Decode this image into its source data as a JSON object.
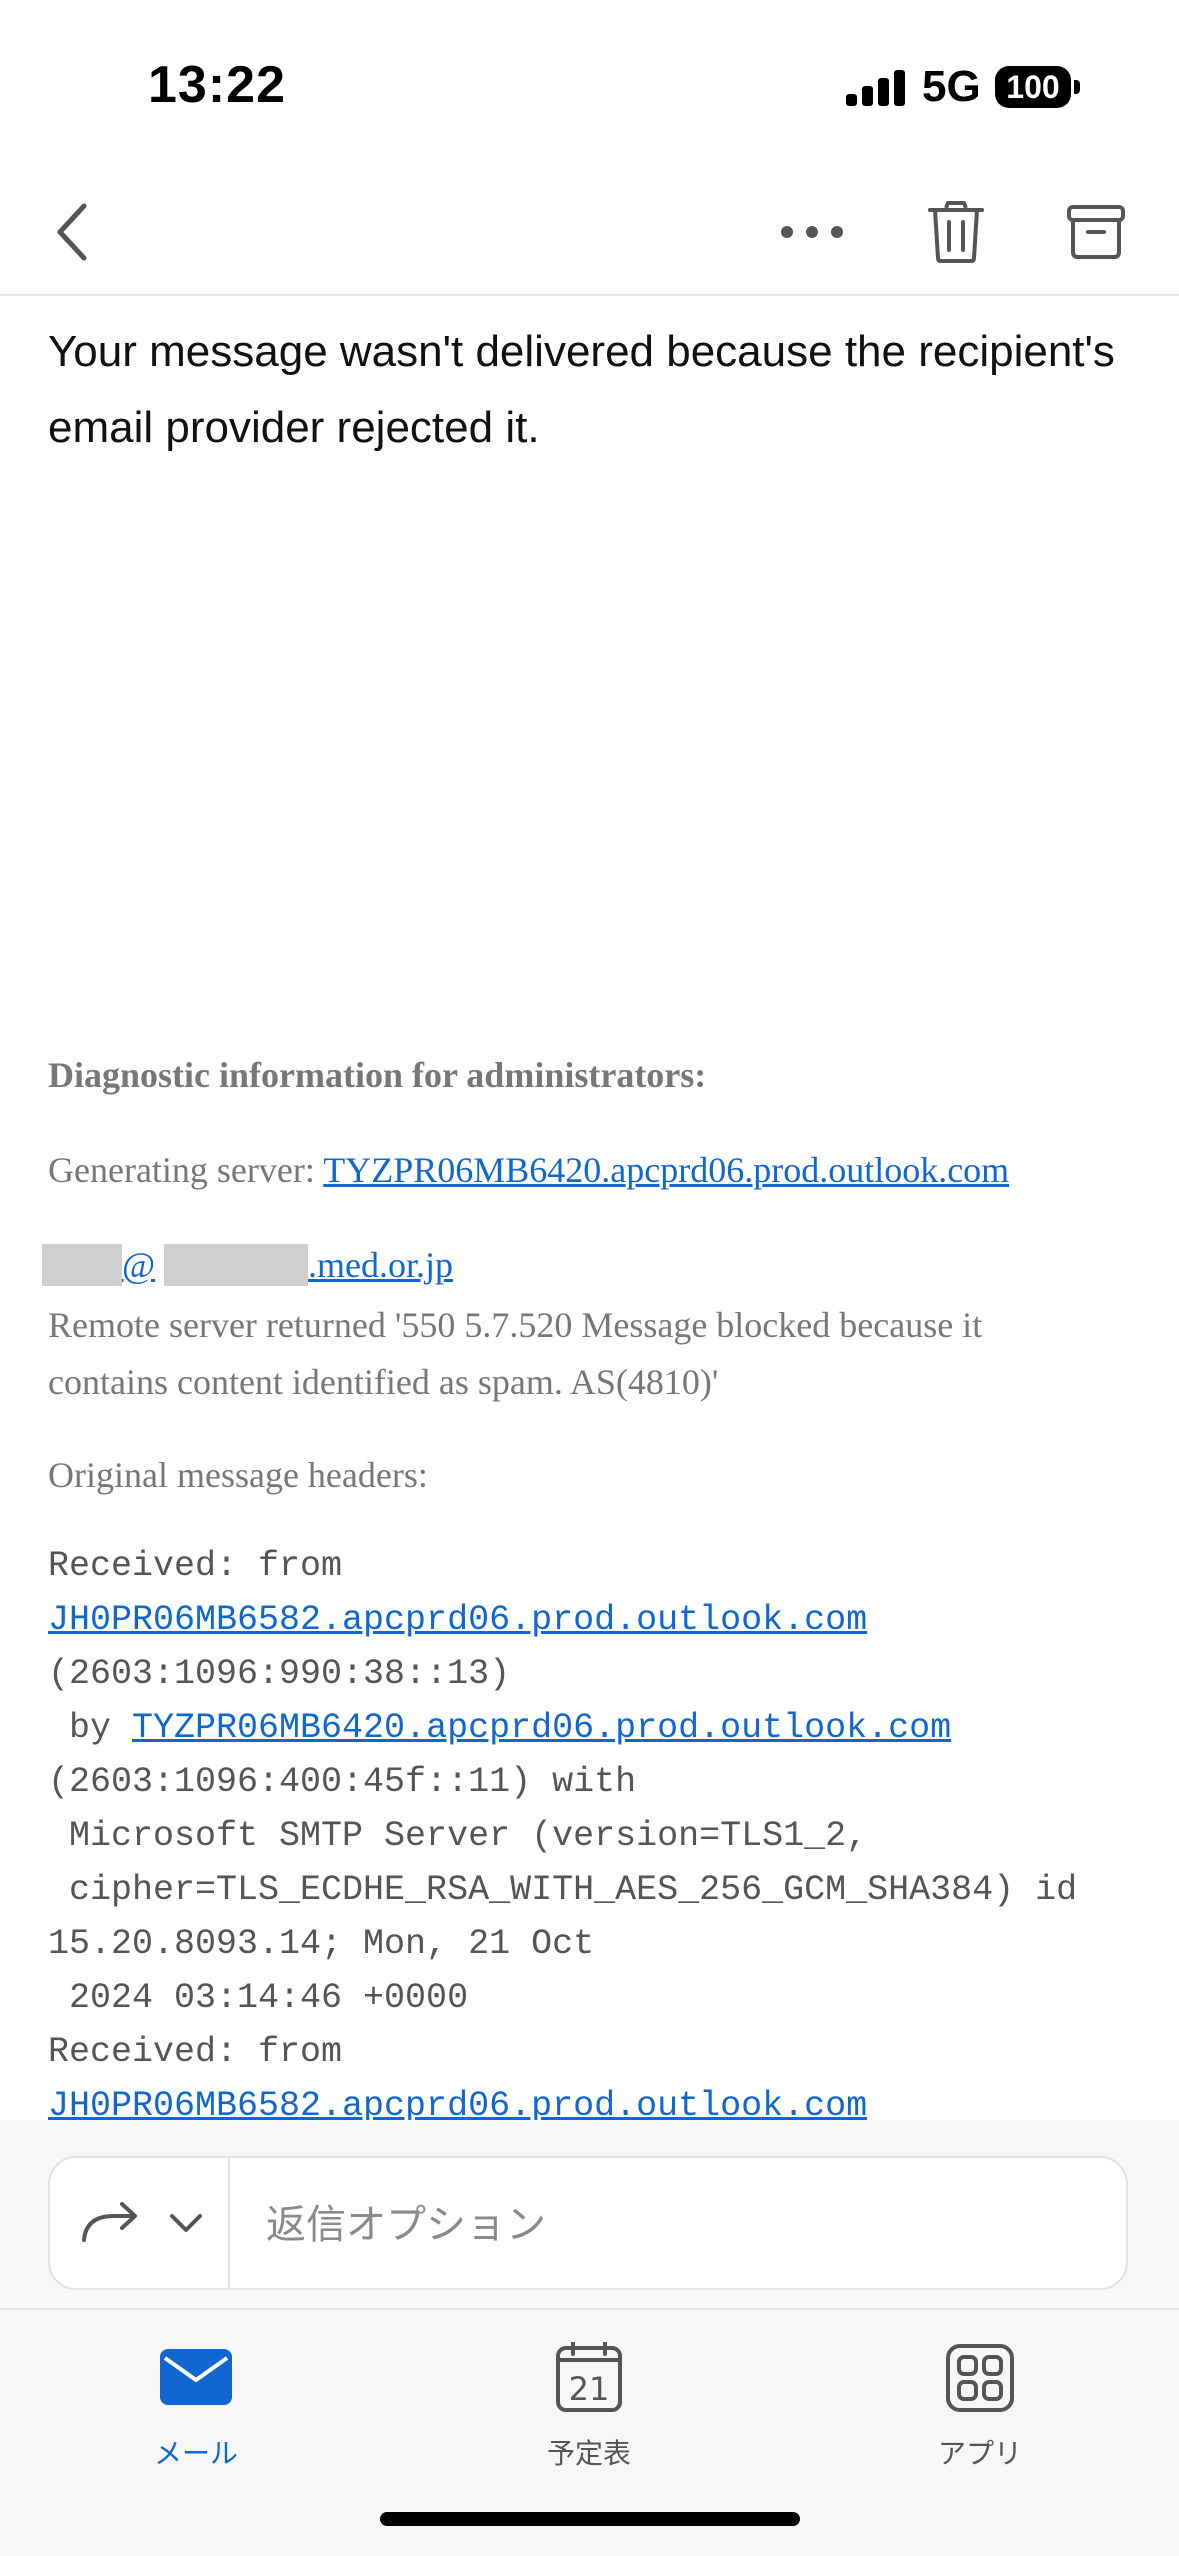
{
  "status_bar": {
    "time": "13:22",
    "network": "5G",
    "battery": "100"
  },
  "toolbar": {
    "icons": [
      "back-chevron-icon",
      "more-icon",
      "trash-icon",
      "archive-icon"
    ]
  },
  "message": {
    "delivery_text": "Your message wasn't delivered because the recipient's email provider rejected it.",
    "diagnostic_title": "Diagnostic information for administrators:",
    "generating_server_label": "Generating server: ",
    "generating_server_link": "TYZPR06MB6420.apcprd06.prod.outlook.com",
    "recipient_at": "@",
    "recipient_domain": ".med.or.jp",
    "remote_server_text": "Remote server returned '550 5.7.520 Message blocked because it contains content identified as spam. AS(4810)'",
    "original_headers_label": "Original message headers:",
    "headers": {
      "received_from_1": "Received: from",
      "link_jh0": "JH0PR06MB6582.apcprd06.prod.outlook.com",
      "ip_1": "(2603:1096:990:38::13)",
      "by_prefix": " by ",
      "link_tyz": "TYZPR06MB6420.apcprd06.prod.outlook.com",
      "ip_2": "(2603:1096:400:45f::11) with",
      "smtp_line": " Microsoft SMTP Server (version=TLS1_2,",
      "cipher_line": " cipher=TLS_ECDHE_RSA_WITH_AES_256_GCM_SHA384) id",
      "id_line": "15.20.8093.14; Mon, 21 Oct",
      "date_line": " 2024 03:14:46 +0000",
      "received_from_2": "Received: from",
      "link_jh0_2": "JH0PR06MB6582.apcprd06.prod.outlook.com"
    }
  },
  "reply_bar": {
    "placeholder": "返信オプション"
  },
  "tabbar": {
    "mail_label": "メール",
    "calendar_label": "予定表",
    "calendar_day": "21",
    "apps_label": "アプリ",
    "active_color": "#1167d0",
    "inactive_color": "#555555"
  }
}
